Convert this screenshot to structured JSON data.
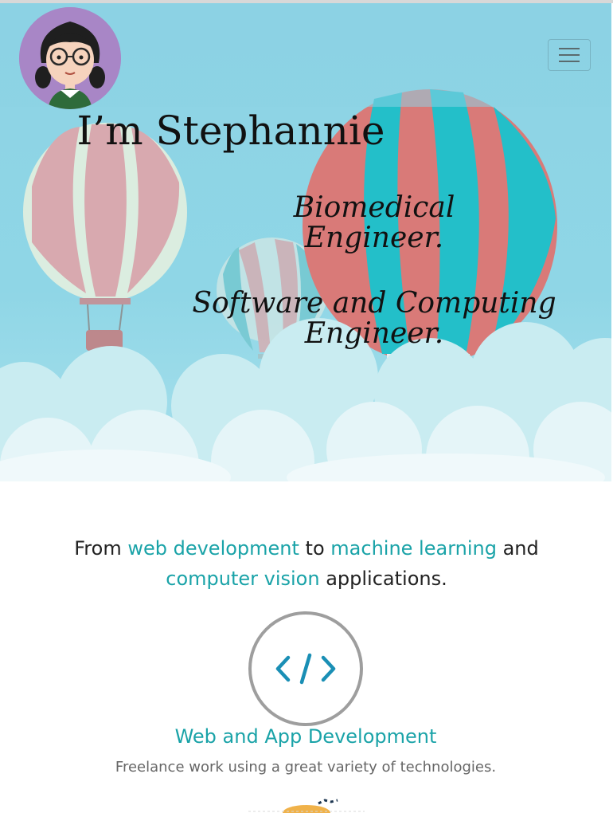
{
  "hero": {
    "name": "I’m Stephannie",
    "role_one": "Biomedical Engineer.",
    "role_two": "Software and Computing Engineer."
  },
  "navbar": {
    "avatar_icon": "cartoon-girl-avatar-icon",
    "menu_icon": "hamburger-menu-icon"
  },
  "intro": {
    "prefix": "From ",
    "link_web": "web development",
    "middle": " to ",
    "link_ml": "machine learning",
    "and": " and ",
    "link_cv": "computer vision",
    "suffix": " applications."
  },
  "services": [
    {
      "icon": "code-icon",
      "title": "Web and App Development",
      "description": "Freelance work using a great variety of technologies."
    }
  ],
  "colors": {
    "accent": "#1aa3a8",
    "sky": "#8fd6e6",
    "avatar_bg": "#a886c6",
    "balloon_red": "#d97a78",
    "balloon_teal": "#23bfc9"
  }
}
